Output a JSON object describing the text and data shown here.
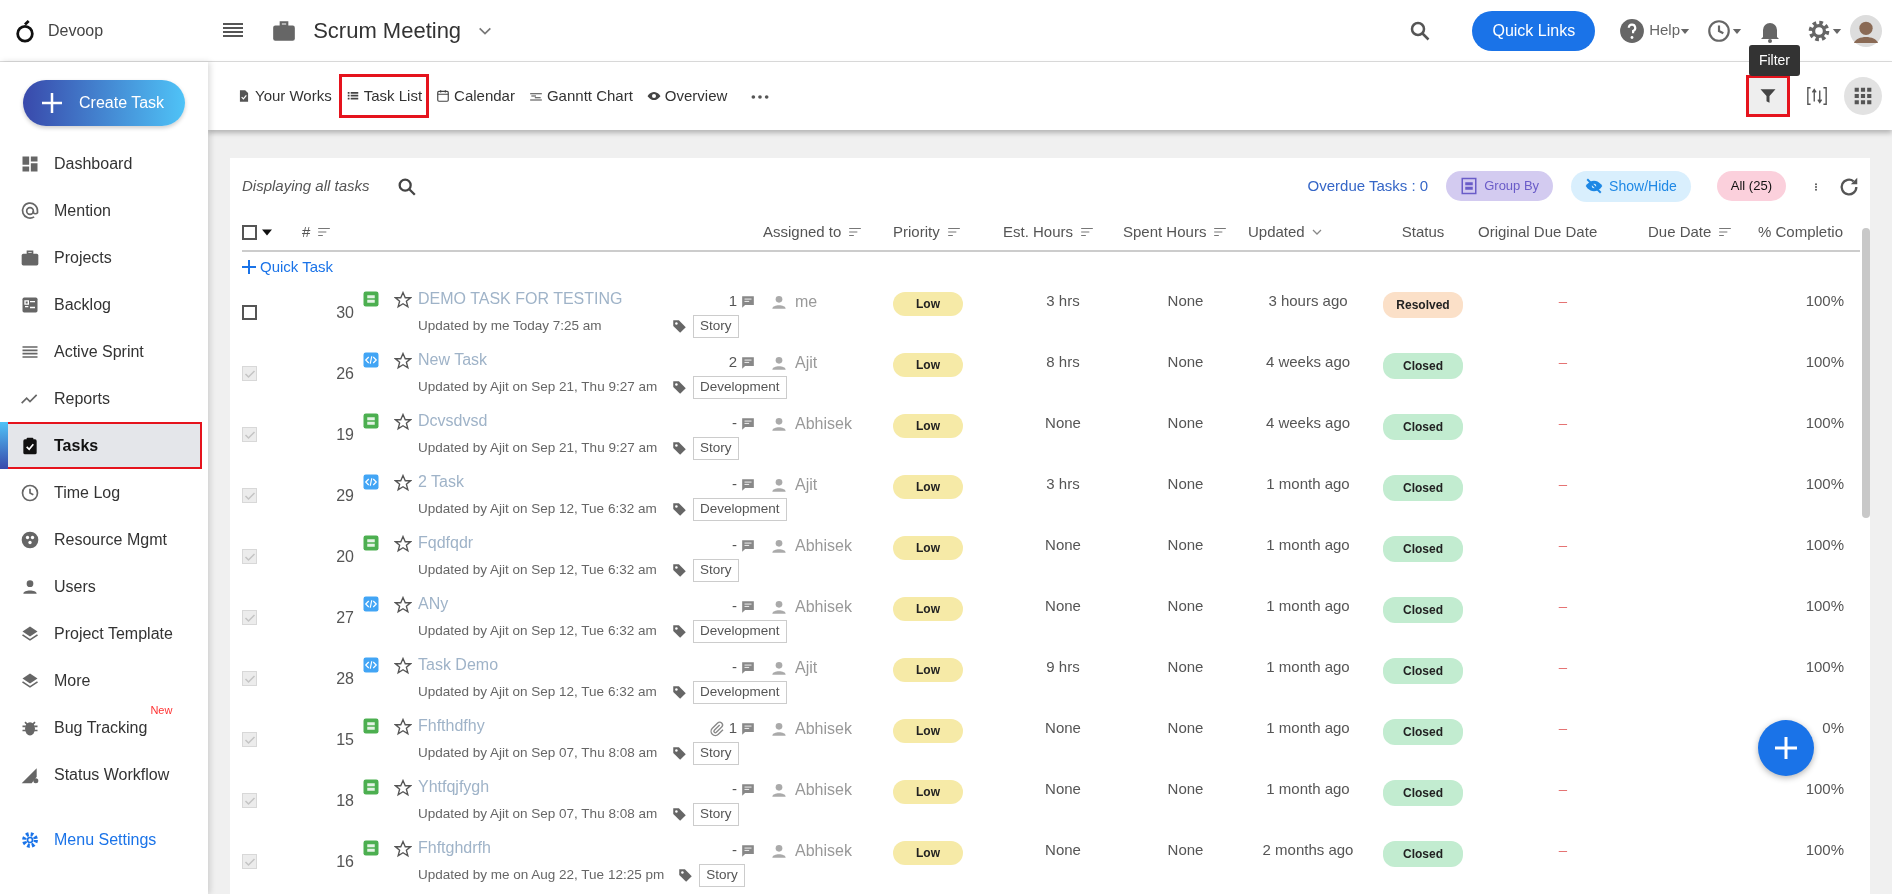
{
  "header": {
    "app_name": "Devoop",
    "project": "Scrum Meeting",
    "quick_links": "Quick Links",
    "help": "Help"
  },
  "tooltip": "Filter",
  "filter": {
    "outlined": true
  },
  "sidebar": {
    "create": "Create Task",
    "items": [
      {
        "label": "Dashboard",
        "selected": false
      },
      {
        "label": "Mention",
        "selected": false
      },
      {
        "label": "Projects",
        "selected": false
      },
      {
        "label": "Backlog",
        "selected": false
      },
      {
        "label": "Active Sprint",
        "selected": false
      },
      {
        "label": "Reports",
        "selected": false
      },
      {
        "label": "Tasks",
        "selected": true
      },
      {
        "label": "Time Log",
        "selected": false
      },
      {
        "label": "Resource Mgmt",
        "selected": false
      },
      {
        "label": "Users",
        "selected": false
      },
      {
        "label": "Project Template",
        "selected": false
      },
      {
        "label": "More",
        "selected": false
      },
      {
        "label": "Bug Tracking",
        "selected": false,
        "badge": "New"
      },
      {
        "label": "Status Workflow",
        "selected": false
      }
    ],
    "menu_settings": "Menu Settings"
  },
  "tabs": [
    {
      "label": "Your Works",
      "selected": false
    },
    {
      "label": "Task List",
      "selected": true
    },
    {
      "label": "Calendar",
      "selected": false
    },
    {
      "label": "Ganntt Chart",
      "selected": false
    },
    {
      "label": "Overview",
      "selected": false
    }
  ],
  "toolbar": {
    "displaying": "Displaying all tasks",
    "overdue": "Overdue Tasks : 0",
    "group_by": "Group By",
    "show_hide": "Show/Hide",
    "all": "All (25)"
  },
  "columns": [
    "#",
    "Assigned to",
    "Priority",
    "Est. Hours",
    "Spent Hours",
    "Updated",
    "Status",
    "Original Due Date",
    "Due Date",
    "% Completio"
  ],
  "quick_task": "Quick Task",
  "select_all": {
    "checked": false
  },
  "rows": [
    {
      "checked": false,
      "number": "30",
      "kind": "story",
      "title": "DEMO TASK FOR TESTING",
      "updated_by": "Updated by me Today 7:25 am",
      "tag": "Story",
      "comments": "1",
      "assignee": "me",
      "priority": "Low",
      "est": "3 hrs",
      "spent": "None",
      "updated": "3 hours ago",
      "status": {
        "label": "Resolved",
        "color": "#fbe0c8"
      },
      "original_due": "–",
      "completion": "100%"
    },
    {
      "checked": true,
      "number": "26",
      "kind": "development",
      "title": "New Task",
      "updated_by": "Updated by Ajit on Sep 21, Thu 9:27 am",
      "tag": "Development",
      "comments": "2",
      "assignee": "Ajit",
      "priority": "Low",
      "est": "8 hrs",
      "spent": "None",
      "updated": "4 weeks ago",
      "status": {
        "label": "Closed",
        "color": "#c2ecd0"
      },
      "original_due": "–",
      "completion": "100%"
    },
    {
      "checked": true,
      "number": "19",
      "kind": "story",
      "title": "Dcvsdvsd",
      "updated_by": "Updated by Ajit on Sep 21, Thu 9:27 am",
      "tag": "Story",
      "comments": "-",
      "assignee": "Abhisek",
      "priority": "Low",
      "est": "None",
      "spent": "None",
      "updated": "4 weeks ago",
      "status": {
        "label": "Closed",
        "color": "#c2ecd0"
      },
      "original_due": "–",
      "completion": "100%"
    },
    {
      "checked": true,
      "number": "29",
      "kind": "development",
      "title": "2 Task",
      "updated_by": "Updated by Ajit on Sep 12, Tue 6:32 am",
      "tag": "Development",
      "comments": "-",
      "assignee": "Ajit",
      "priority": "Low",
      "est": "3 hrs",
      "spent": "None",
      "updated": "1 month ago",
      "status": {
        "label": "Closed",
        "color": "#c2ecd0"
      },
      "original_due": "–",
      "completion": "100%"
    },
    {
      "checked": true,
      "number": "20",
      "kind": "story",
      "title": "Fqdfqdr",
      "updated_by": "Updated by Ajit on Sep 12, Tue 6:32 am",
      "tag": "Story",
      "comments": "-",
      "assignee": "Abhisek",
      "priority": "Low",
      "est": "None",
      "spent": "None",
      "updated": "1 month ago",
      "status": {
        "label": "Closed",
        "color": "#c2ecd0"
      },
      "original_due": "–",
      "completion": "100%"
    },
    {
      "checked": true,
      "number": "27",
      "kind": "development",
      "title": "ANy",
      "updated_by": "Updated by Ajit on Sep 12, Tue 6:32 am",
      "tag": "Development",
      "comments": "-",
      "assignee": "Abhisek",
      "priority": "Low",
      "est": "None",
      "spent": "None",
      "updated": "1 month ago",
      "status": {
        "label": "Closed",
        "color": "#c2ecd0"
      },
      "original_due": "–",
      "completion": "100%"
    },
    {
      "checked": true,
      "number": "28",
      "kind": "development",
      "title": "Task Demo",
      "updated_by": "Updated by Ajit on Sep 12, Tue 6:32 am",
      "tag": "Development",
      "comments": "-",
      "assignee": "Ajit",
      "priority": "Low",
      "est": "9 hrs",
      "spent": "None",
      "updated": "1 month ago",
      "status": {
        "label": "Closed",
        "color": "#c2ecd0"
      },
      "original_due": "–",
      "completion": "100%"
    },
    {
      "checked": true,
      "number": "15",
      "kind": "story",
      "title": "Fhfthdfhy",
      "updated_by": "Updated by Ajit on Sep 07, Thu 8:08 am",
      "tag": "Story",
      "attachment": true,
      "comments": "1",
      "assignee": "Abhisek",
      "priority": "Low",
      "est": "None",
      "spent": "None",
      "updated": "1 month ago",
      "status": {
        "label": "Closed",
        "color": "#c2ecd0"
      },
      "original_due": "–",
      "completion": "0%"
    },
    {
      "checked": true,
      "number": "18",
      "kind": "story",
      "title": "Yhtfqjfygh",
      "updated_by": "Updated by Ajit on Sep 07, Thu 8:08 am",
      "tag": "Story",
      "comments": "-",
      "assignee": "Abhisek",
      "priority": "Low",
      "est": "None",
      "spent": "None",
      "updated": "1 month ago",
      "status": {
        "label": "Closed",
        "color": "#c2ecd0"
      },
      "original_due": "–",
      "completion": "100%"
    },
    {
      "checked": true,
      "number": "16",
      "kind": "story",
      "title": "Fhftghdrfh",
      "updated_by": "Updated by me on Aug 22, Tue 12:25 pm",
      "tag": "Story",
      "comments": "-",
      "assignee": "Abhisek",
      "priority": "Low",
      "est": "None",
      "spent": "None",
      "updated": "2 months ago",
      "status": {
        "label": "Closed",
        "color": "#c2ecd0"
      },
      "original_due": "–",
      "completion": "100%"
    }
  ]
}
